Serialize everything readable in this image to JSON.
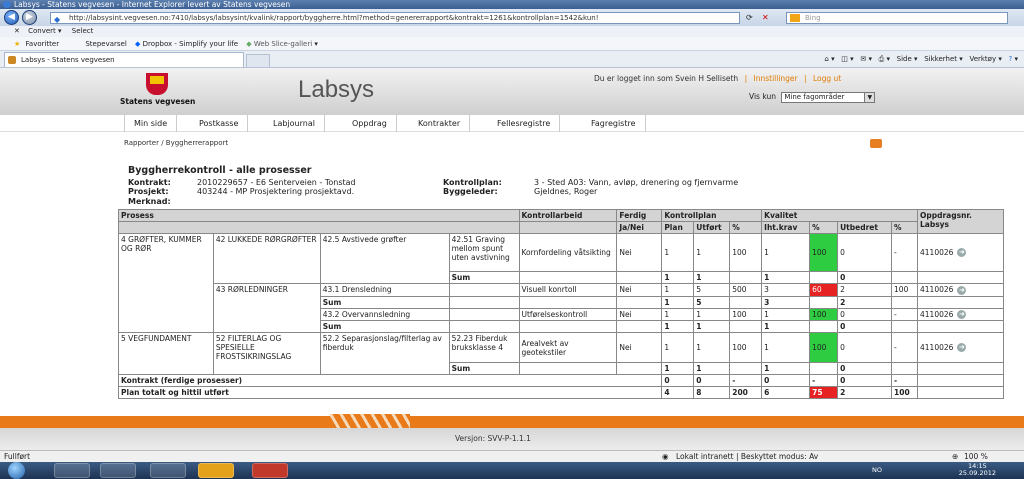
{
  "window": {
    "title": "Labsys - Statens vegvesen - Internet Explorer levert av Statens vegvesen"
  },
  "browser": {
    "url": "http://labsysint.vegvesen.no:7410/labsys/labsysint/kvalink/rapport/byggherre.html?method=genererrapport&kontrakt=1261&kontrollplan=1542&kun!",
    "search_placeholder": "Bing",
    "convert_label": "Convert",
    "select_label": "Select",
    "favorites_label": "Favoritter",
    "fav_items": [
      "Stepevarsel",
      "Dropbox - Simplify your life",
      "Web Slice-galleri"
    ],
    "tab_label": "Labsys - Statens vegvesen",
    "tools": [
      "Side",
      "Sikkerhet",
      "Verktøy"
    ]
  },
  "header": {
    "logo_text": "Statens vegvesen",
    "app_title": "Labsys",
    "logged_in": "Du er logget inn som Svein H Selliseth",
    "settings": "Innstillinger",
    "logout": "Logg ut",
    "sep": "|",
    "vis_kun_label": "Vis kun",
    "vis_kun_value": "Mine fagområder"
  },
  "menu": [
    "Min side",
    "Postkasse",
    "Labjournal",
    "Oppdrag",
    "Kontrakter",
    "Fellesregistre",
    "Fagregistre"
  ],
  "breadcrumb": "Rapporter / Byggherrerapport",
  "report": {
    "title": "Byggherrekontroll - alle prosesser",
    "kontrakt_label": "Kontrakt:",
    "kontrakt": "2010229657 - E6 Senterveien - Tonstad",
    "prosjekt_label": "Prosjekt:",
    "prosjekt": "403244 - MP Prosjektering prosjektavd.",
    "merknad_label": "Merknad:",
    "kontrollplan_label": "Kontrollplan:",
    "kontrollplan": "3 - Sted A03: Vann, avløp, drenering og fjernvarme",
    "byggeleder_label": "Byggeleder:",
    "byggeleder": "Gjeldnes, Roger"
  },
  "table": {
    "h": {
      "prosess": "Prosess",
      "kontrollarbeid": "Kontrollarbeid",
      "ferdig": "Ferdig",
      "kontrollplan": "Kontrollplan",
      "kvalitet": "Kvalitet",
      "oppdrag": "Oppdragsnr. Labsys",
      "janei": "Ja/Nei",
      "plan": "Plan",
      "utfort": "Utført",
      "pct": "%",
      "ihtkrav": "Iht.krav",
      "utbedret": "Utbedret"
    },
    "r1": {
      "p1": "4 GRØFTER, KUMMER OG RØR",
      "p2": "42 LUKKEDE RØRGRØFTER",
      "p3": "42.5 Avstivede grøfter",
      "p4": "42.51 Graving mellom spunt uten avstivning",
      "ka": "Kornfordeling våtsikting",
      "fe": "Nei",
      "plan": "1",
      "utf": "1",
      "pct": "100",
      "iht": "1",
      "kpct": "100",
      "utb": "0",
      "upct": "-",
      "opp": "4110026"
    },
    "s1": {
      "label": "Sum",
      "plan": "1",
      "utf": "1",
      "iht": "1",
      "utb": "0"
    },
    "r2": {
      "p2": "43 RØRLEDNINGER",
      "p3": "43.1 Drensledning",
      "ka": "Visuell konrtoll",
      "fe": "Nei",
      "plan": "1",
      "utf": "5",
      "pct": "500",
      "iht": "3",
      "kpct": "60",
      "utb": "2",
      "upct": "100",
      "opp": "4110026"
    },
    "s2": {
      "label": "Sum",
      "plan": "1",
      "utf": "5",
      "iht": "3",
      "utb": "2"
    },
    "r3": {
      "p3": "43.2 Overvannsledning",
      "ka": "Utførelseskontroll",
      "fe": "Nei",
      "plan": "1",
      "utf": "1",
      "pct": "100",
      "iht": "1",
      "kpct": "100",
      "utb": "0",
      "upct": "-",
      "opp": "4110026"
    },
    "s3": {
      "label": "Sum",
      "plan": "1",
      "utf": "1",
      "iht": "1",
      "utb": "0"
    },
    "r4": {
      "p1": "5 VEGFUNDAMENT",
      "p2": "52 FILTERLAG OG SPESIELLE FROSTSIKRINGSLAG",
      "p3": "52.2 Separasjonslag/filterlag av fiberduk",
      "p4": "52.23 Fiberduk bruksklasse 4",
      "ka": "Arealvekt av geotekstiler",
      "fe": "Nei",
      "plan": "1",
      "utf": "1",
      "pct": "100",
      "iht": "1",
      "kpct": "100",
      "utb": "0",
      "upct": "-",
      "opp": "4110026"
    },
    "s4": {
      "label": "Sum",
      "plan": "1",
      "utf": "1",
      "iht": "1",
      "utb": "0"
    },
    "kontrakt": {
      "label": "Kontrakt (ferdige prosesser)",
      "plan": "0",
      "utf": "0",
      "pct": "-",
      "iht": "0",
      "kpct": "-",
      "utb": "0",
      "upct": "-"
    },
    "total": {
      "label": "Plan totalt og hittil utført",
      "plan": "4",
      "utf": "8",
      "pct": "200",
      "iht": "6",
      "kpct": "75",
      "utb": "2",
      "upct": "100"
    }
  },
  "footer": {
    "version": "Versjon: SVV-P-1.1.1"
  },
  "status": {
    "left": "Fullført",
    "zone": "Lokalt intranett | Beskyttet modus: Av",
    "zoom": "100 %"
  },
  "taskbar": {
    "lang": "NO",
    "time": "14:15",
    "date": "25.09.2012"
  },
  "colors": {
    "green": "#2ecc40",
    "red": "#e62222",
    "orange": "#e87a1a"
  }
}
